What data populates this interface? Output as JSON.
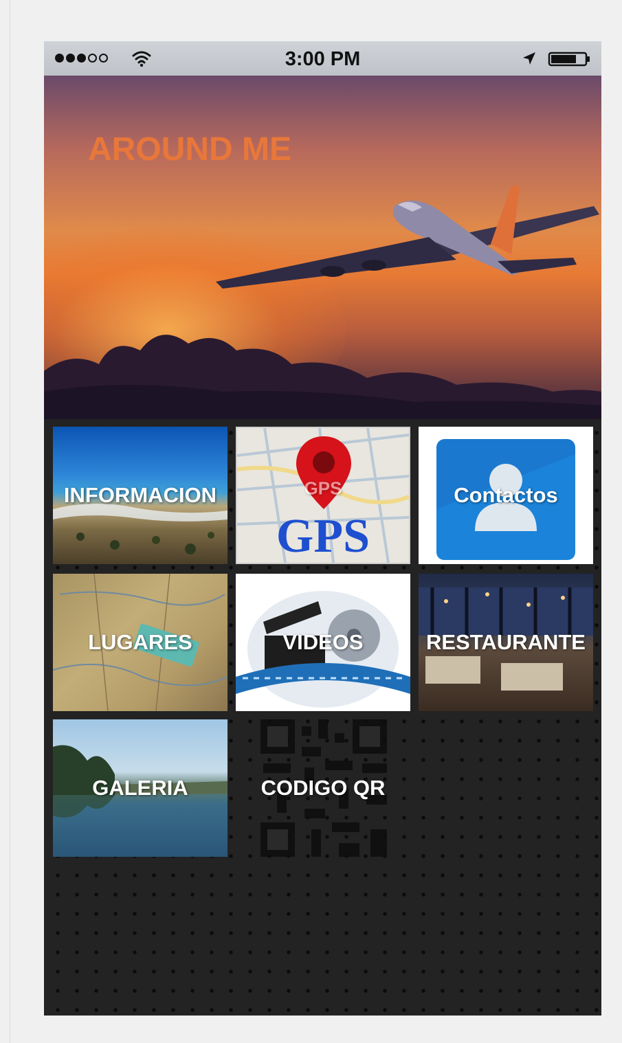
{
  "status_bar": {
    "time": "3:00 PM",
    "signal_icon": "signal-dots-icon",
    "wifi_icon": "wifi-icon",
    "location_icon": "location-arrow-icon",
    "battery_icon": "battery-icon"
  },
  "hero": {
    "title": "AROUND ME",
    "image": "airplane-sunset-image"
  },
  "menu": {
    "items": [
      {
        "label": "INFORMACION",
        "image": "beach-coast-image"
      },
      {
        "label": "GPS",
        "image": "gps-map-pin-image"
      },
      {
        "label": "Contactos",
        "image": "contacts-icon"
      },
      {
        "label": "LUGARES",
        "image": "world-map-image"
      },
      {
        "label": "VIDEOS",
        "image": "film-reel-icon"
      },
      {
        "label": "RESTAURANTE",
        "image": "restaurant-interior-image"
      },
      {
        "label": "GALERIA",
        "image": "lake-landscape-image"
      },
      {
        "label": "CODIGO QR",
        "image": "qr-code-icon"
      }
    ]
  },
  "colors": {
    "title": "#e8773a",
    "grid_background": "#232323",
    "status_bar": "#c8ccd1"
  }
}
